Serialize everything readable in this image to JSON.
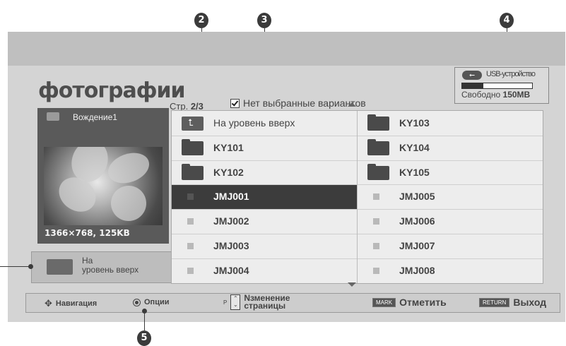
{
  "callouts": [
    "2",
    "3",
    "4",
    "5"
  ],
  "header": {
    "title": "фотографии",
    "page_prefix": "Стр.",
    "page_value": "2/3",
    "selection_text": "Нет выбранные вариантов"
  },
  "usb": {
    "icon": "usb-icon",
    "device_name": "USB-устройство",
    "free_label": "Свободно",
    "free_value": "150MB",
    "used_fraction": 0.3
  },
  "preview": {
    "name": "Вождение1",
    "info": "1366×768, 125KB"
  },
  "up_button": {
    "line1": "На",
    "line2": "уровень вверх"
  },
  "list": {
    "left": [
      {
        "label": "На уровень вверх",
        "type": "up"
      },
      {
        "label": "KY101",
        "type": "folder"
      },
      {
        "label": "KY102",
        "type": "folder"
      },
      {
        "label": "JMJ001",
        "type": "file",
        "selected": true
      },
      {
        "label": "JMJ002",
        "type": "file"
      },
      {
        "label": "JMJ003",
        "type": "file"
      },
      {
        "label": "JMJ004",
        "type": "file"
      }
    ],
    "right": [
      {
        "label": "KY103",
        "type": "folder"
      },
      {
        "label": "KY104",
        "type": "folder"
      },
      {
        "label": "KY105",
        "type": "folder"
      },
      {
        "label": "JMJ005",
        "type": "file"
      },
      {
        "label": "JMJ006",
        "type": "file"
      },
      {
        "label": "JMJ007",
        "type": "file"
      },
      {
        "label": "JMJ008",
        "type": "file"
      }
    ]
  },
  "bottom": {
    "nav_label": "Навигация",
    "options_label": "Опции",
    "page_key": "P",
    "page_change_line1": "Nзменение",
    "page_change_line2": "страницы",
    "mark_key": "MARK",
    "mark_label": "Отметить",
    "return_key": "RETURN",
    "return_label": "Выход"
  }
}
